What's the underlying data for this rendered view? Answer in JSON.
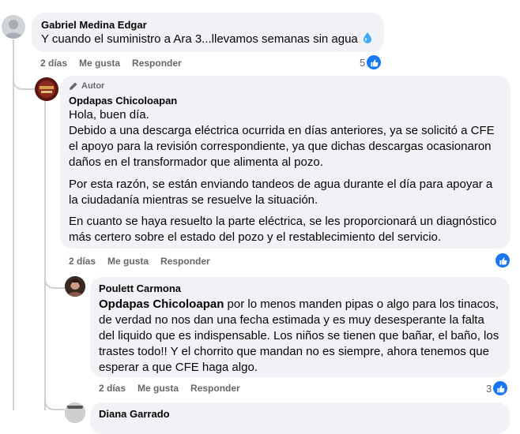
{
  "comments": [
    {
      "author": "Gabriel Medina Edgar",
      "text": "Y cuando el suministro a Ara 3...llevamos semanas sin agua",
      "time": "2 días",
      "like_label": "Me gusta",
      "reply_label": "Responder",
      "reactions": "5",
      "emoji_icon": "water-drop-icon",
      "avatar_icon": "default-user-icon"
    },
    {
      "badge": "Autor",
      "author": "Opdapas Chicoloapan",
      "paragraphs": [
        "Hola, buen día.",
        "Debido a una descarga eléctrica ocurrida en días anteriores, ya se solicitó a CFE el apoyo para la revisión correspondiente, ya que dichas descargas ocasionaron daños en el transformador que alimenta al pozo.",
        "Por esta razón, se están enviando tandeos de agua durante el día para apoyar a la ciudadanía mientras se resuelve la situación.",
        "En cuanto se haya resuelto la parte eléctrica, se les proporcionará un diagnóstico más certero sobre el estado del pozo y el restablecimiento del servicio."
      ],
      "time": "2 días",
      "like_label": "Me gusta",
      "reply_label": "Responder",
      "avatar_text": "Opdapas"
    },
    {
      "author": "Poulett Carmona",
      "mention": "Opdapas Chicoloapan",
      "text": "por lo menos manden pipas o algo para los tinacos, de verdad no nos dan una fecha estimada y es muy desesperante la falta del liquido que es indispensable. Los niños se tienen que bañar, el baño, los trastes todo!! Y el chorrito que mandan no es siempre, ahora tenemos que esperar a que CFE haga algo.",
      "time": "2 días",
      "like_label": "Me gusta",
      "reply_label": "Responder",
      "reactions": "3"
    },
    {
      "author": "Diana Garrado"
    }
  ],
  "colors": {
    "bubble": "#f0f2f5",
    "like_blue": "#1877f2",
    "meta_gray": "#65676b",
    "thread_line": "#ced0d4"
  }
}
